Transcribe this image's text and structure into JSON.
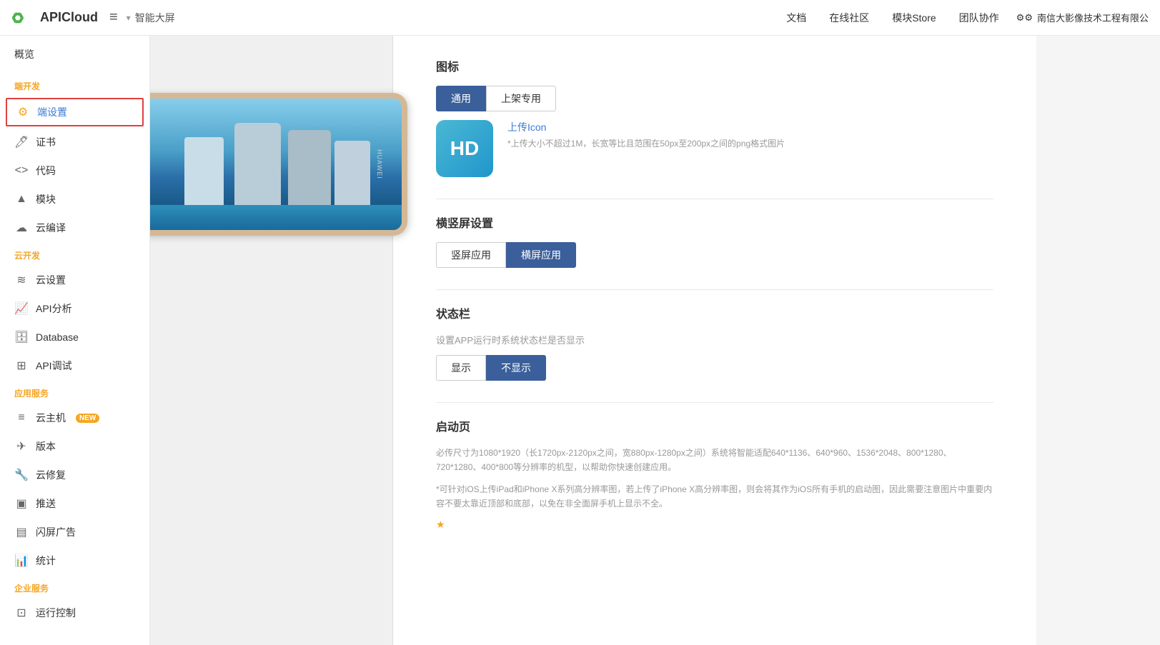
{
  "topNav": {
    "logo": "APICloud",
    "menuIcon": "≡",
    "breadcrumb": {
      "arrow": "▾",
      "text": "智能大屏"
    },
    "links": [
      "文档",
      "在线社区",
      "模块Store",
      "团队协作"
    ],
    "userIcon": "⚙",
    "userName": "南信大影像技术工程有限公"
  },
  "sidebar": {
    "overview": "概览",
    "sections": [
      {
        "label": "端开发",
        "items": [
          {
            "id": "duan-shezhi",
            "icon": "gear",
            "label": "端设置",
            "active": true
          },
          {
            "id": "zhengshu",
            "icon": "cert",
            "label": "证书",
            "active": false
          },
          {
            "id": "daima",
            "icon": "code",
            "label": "代码",
            "active": false
          },
          {
            "id": "mokuai",
            "icon": "module",
            "label": "模块",
            "active": false
          },
          {
            "id": "yunbianyì",
            "icon": "cloud-code",
            "label": "云编译",
            "active": false
          }
        ]
      },
      {
        "label": "云开发",
        "items": [
          {
            "id": "yun-shezhi",
            "icon": "cloud-settings",
            "label": "云设置",
            "active": false
          },
          {
            "id": "api-fenxi",
            "icon": "chart",
            "label": "API分析",
            "active": false
          },
          {
            "id": "database",
            "icon": "db",
            "label": "Database",
            "active": false
          },
          {
            "id": "api-tiaoshi",
            "icon": "api-test",
            "label": "API调试",
            "active": false
          }
        ]
      },
      {
        "label": "应用服务",
        "items": [
          {
            "id": "yun-zhuji",
            "icon": "server",
            "label": "云主机",
            "badge": "NEW",
            "active": false
          },
          {
            "id": "banben",
            "icon": "version",
            "label": "版本",
            "active": false
          },
          {
            "id": "yunxiufu",
            "icon": "wrench",
            "label": "云修复",
            "active": false
          },
          {
            "id": "tuisong",
            "icon": "push",
            "label": "推送",
            "active": false
          },
          {
            "id": "shanping-guanggao",
            "icon": "ad",
            "label": "闪屏广告",
            "active": false
          },
          {
            "id": "tongji",
            "icon": "stats",
            "label": "统计",
            "active": false
          }
        ]
      },
      {
        "label": "企业服务",
        "items": [
          {
            "id": "yunxing-kongzhi",
            "icon": "control",
            "label": "运行控制",
            "active": false
          }
        ]
      }
    ]
  },
  "content": {
    "iconSection": {
      "title": "图标",
      "tabs": [
        "通用",
        "上架专用"
      ],
      "activeTab": 0,
      "iconPreview": "HD",
      "uploadLinkText": "上传Icon",
      "uploadHint": "*上传大小不超过1M，长宽等比且范围在50px至200px之间的png格式图片"
    },
    "orientationSection": {
      "title": "横竖屏设置",
      "tabs": [
        "竖屏应用",
        "横屏应用"
      ],
      "activeTab": 1
    },
    "statusBarSection": {
      "title": "状态栏",
      "desc": "设置APP运行时系统状态栏是否显示",
      "tabs": [
        "显示",
        "不显示"
      ],
      "activeTab": 1
    },
    "launchSection": {
      "title": "启动页",
      "desc1": "必传尺寸为1080*1920（长1720px-2120px之间，宽880px-1280px之间）系统将智能适配640*1136、640*960、1536*2048、800*1280、720*1280、400*800等分辨率的机型，以帮助你快速创建应用。",
      "desc2": "*可针对iOS上传iPad和iPhone X系列高分辨率图，若上传了iPhone X高分辨率图，则会将其作为iOS所有手机的启动图，因此需要注意图片中重要内容不要太靠近顶部和底部，以免在非全面屏手机上显示不全。",
      "starLabel": "★"
    }
  }
}
